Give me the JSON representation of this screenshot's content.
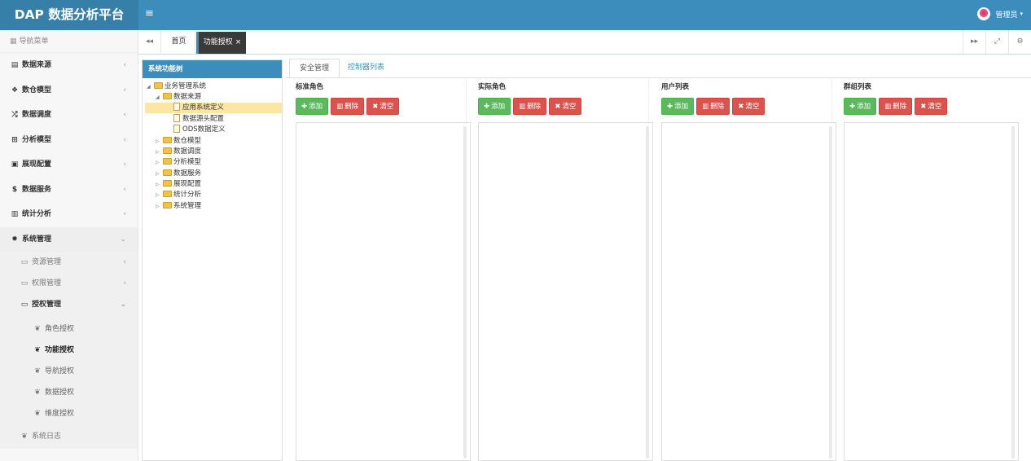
{
  "header": {
    "app_title": "DAP 数据分析平台",
    "menu_toggle": "≡",
    "user_name": "管理员",
    "brand_color": "#3c8dbc"
  },
  "sidebar": {
    "nav_title": "导航菜单",
    "items": [
      {
        "label": "数据来源",
        "icon": "database-icon"
      },
      {
        "label": "数仓模型",
        "icon": "cubes-icon"
      },
      {
        "label": "数据调度",
        "icon": "random-icon"
      },
      {
        "label": "分析模型",
        "icon": "sitemap-icon"
      },
      {
        "label": "展现配置",
        "icon": "film-icon"
      },
      {
        "label": "数据服务",
        "icon": "dollar-icon"
      },
      {
        "label": "统计分析",
        "icon": "bar-chart-icon"
      },
      {
        "label": "系统管理",
        "icon": "cog-icon"
      }
    ],
    "sub_items": [
      {
        "label": "资源管理"
      },
      {
        "label": "权限管理"
      },
      {
        "label": "授权管理"
      }
    ],
    "auth_items": [
      {
        "label": "角色授权"
      },
      {
        "label": "功能授权"
      },
      {
        "label": "导航授权"
      },
      {
        "label": "数据授权"
      },
      {
        "label": "维度授权"
      }
    ],
    "log_label": "系统日志"
  },
  "tabbar": {
    "home_label": "首页",
    "active_label": "功能授权"
  },
  "tree": {
    "title": "系统功能树",
    "nodes": [
      {
        "label": "业务管理系统"
      },
      {
        "label": "数据来源"
      },
      {
        "label": "应用系统定义"
      },
      {
        "label": "数据源头配置"
      },
      {
        "label": "ODS数据定义"
      },
      {
        "label": "数仓模型"
      },
      {
        "label": "数据调度"
      },
      {
        "label": "分析模型"
      },
      {
        "label": "数据服务"
      },
      {
        "label": "展现配置"
      },
      {
        "label": "统计分析"
      },
      {
        "label": "系统管理"
      }
    ]
  },
  "content": {
    "tabs": [
      {
        "label": "安全管理"
      },
      {
        "label": "控制器列表"
      }
    ],
    "panels": [
      {
        "title": "标准角色"
      },
      {
        "title": "实际角色"
      },
      {
        "title": "用户列表"
      },
      {
        "title": "群组列表"
      }
    ],
    "add_label": "添加",
    "delete_label": "删除",
    "clear_label": "清空"
  }
}
